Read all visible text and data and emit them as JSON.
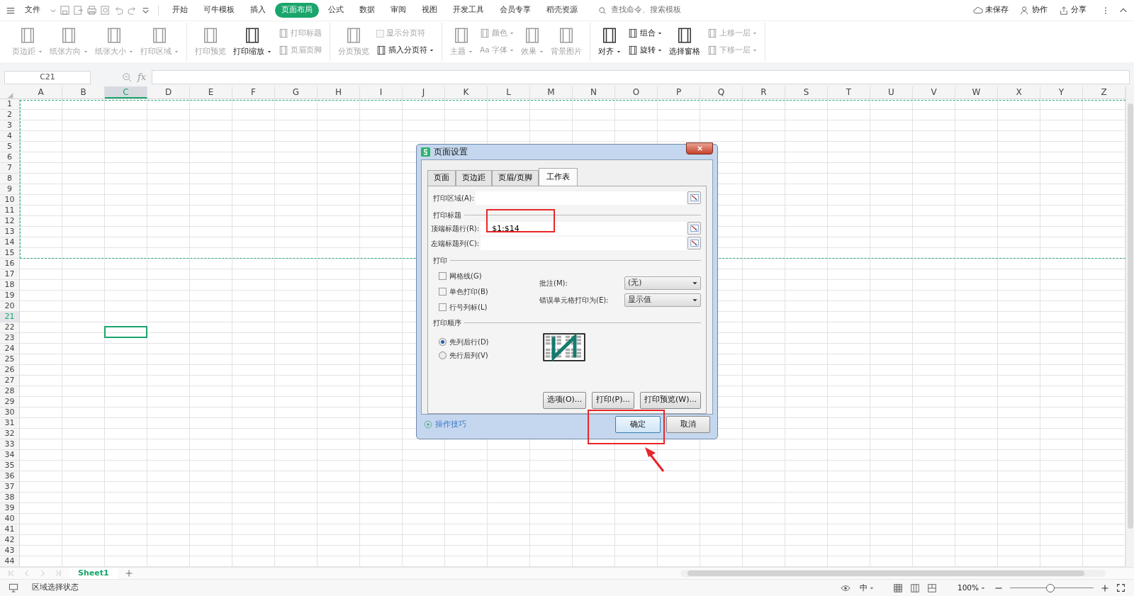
{
  "menu": {
    "file": "文件",
    "tabs": [
      {
        "label": "开始",
        "selected": false
      },
      {
        "label": "可牛模板",
        "selected": false
      },
      {
        "label": "插入",
        "selected": false
      },
      {
        "label": "页面布局",
        "selected": true
      },
      {
        "label": "公式",
        "selected": false
      },
      {
        "label": "数据",
        "selected": false
      },
      {
        "label": "审阅",
        "selected": false
      },
      {
        "label": "视图",
        "selected": false
      },
      {
        "label": "开发工具",
        "selected": false
      },
      {
        "label": "会员专享",
        "selected": false
      },
      {
        "label": "稻壳资源",
        "selected": false
      }
    ],
    "search": {
      "placeholder": "查找命令、搜索模板"
    },
    "actions": [
      {
        "label": "未保存",
        "kind": "cloud"
      },
      {
        "label": "协作",
        "kind": "person"
      },
      {
        "label": "分享",
        "kind": "share"
      }
    ]
  },
  "ribbon": [
    {
      "items": [
        {
          "kind": "large",
          "label": "页边距",
          "dropdown": true,
          "disabled": true
        },
        {
          "kind": "large",
          "label": "纸张方向",
          "dropdown": true,
          "disabled": true
        },
        {
          "kind": "large",
          "label": "纸张大小",
          "dropdown": true,
          "disabled": true
        },
        {
          "kind": "large",
          "label": "打印区域",
          "dropdown": true,
          "disabled": true
        }
      ]
    },
    {
      "items": [
        {
          "kind": "large",
          "label": "打印预览",
          "dropdown": false,
          "disabled": true
        },
        {
          "kind": "large",
          "label": "打印缩放",
          "dropdown": true,
          "disabled": false
        },
        {
          "kind": "stack",
          "items": [
            {
              "kind": "small",
              "label": "打印标题",
              "dropdown": false,
              "disabled": true
            },
            {
              "kind": "small",
              "label": "页眉页脚",
              "dropdown": false,
              "disabled": true
            }
          ]
        }
      ]
    },
    {
      "items": [
        {
          "kind": "large",
          "label": "分页预览",
          "dropdown": false,
          "disabled": true
        },
        {
          "kind": "stack",
          "items": [
            {
              "kind": "check",
              "label": "显示分页符",
              "checked": false,
              "disabled": true
            },
            {
              "kind": "small",
              "label": "插入分页符",
              "dropdown": true,
              "disabled": false
            }
          ]
        }
      ]
    },
    {
      "items": [
        {
          "kind": "large",
          "label": "主题",
          "dropdown": true,
          "disabled": true
        },
        {
          "kind": "stack",
          "items": [
            {
              "kind": "small",
              "label": "颜色",
              "dropdown": true,
              "disabled": true
            },
            {
              "kind": "small",
              "label": "字体",
              "glyph": "Aa",
              "dropdown": true,
              "disabled": true
            }
          ]
        },
        {
          "kind": "large",
          "label": "效果",
          "dropdown": true,
          "disabled": true
        },
        {
          "kind": "large",
          "label": "背景图片",
          "dropdown": false,
          "disabled": true
        }
      ]
    },
    {
      "items": [
        {
          "kind": "large",
          "label": "对齐",
          "dropdown": true,
          "disabled": false
        },
        {
          "kind": "stack",
          "items": [
            {
              "kind": "small",
              "label": "组合",
              "dropdown": true,
              "disabled": false
            },
            {
              "kind": "small",
              "label": "旋转",
              "dropdown": true,
              "disabled": false
            }
          ]
        },
        {
          "kind": "large",
          "label": "选择窗格",
          "dropdown": false,
          "disabled": false
        },
        {
          "kind": "stack",
          "items": [
            {
              "kind": "small",
              "label": "上移一层",
              "dropdown": true,
              "disabled": true
            },
            {
              "kind": "small",
              "label": "下移一层",
              "dropdown": true,
              "disabled": true
            }
          ]
        }
      ]
    }
  ],
  "formula_bar": {
    "name_box": "C21",
    "fx": "fx"
  },
  "sheet": {
    "columns": [
      {
        "label": "A",
        "selected": false
      },
      {
        "label": "B",
        "selected": false
      },
      {
        "label": "C",
        "selected": true
      },
      {
        "label": "D",
        "selected": false
      },
      {
        "label": "E",
        "selected": false
      },
      {
        "label": "F",
        "selected": false
      },
      {
        "label": "G",
        "selected": false
      },
      {
        "label": "H",
        "selected": false
      },
      {
        "label": "I",
        "selected": false
      },
      {
        "label": "J",
        "selected": false
      },
      {
        "label": "K",
        "selected": false
      },
      {
        "label": "L",
        "selected": false
      },
      {
        "label": "M",
        "selected": false
      },
      {
        "label": "N",
        "selected": false
      },
      {
        "label": "O",
        "selected": false
      },
      {
        "label": "P",
        "selected": false
      },
      {
        "label": "Q",
        "selected": false
      },
      {
        "label": "R",
        "selected": false
      },
      {
        "label": "S",
        "selected": false
      },
      {
        "label": "T",
        "selected": false
      },
      {
        "label": "U",
        "selected": false
      },
      {
        "label": "V",
        "selected": false
      },
      {
        "label": "W",
        "selected": false
      },
      {
        "label": "X",
        "selected": false
      },
      {
        "label": "Y",
        "selected": false
      },
      {
        "label": "Z",
        "selected": false
      }
    ],
    "rows": [
      {
        "label": "1",
        "selected": false
      },
      {
        "label": "2",
        "selected": false
      },
      {
        "label": "3",
        "selected": false
      },
      {
        "label": "4",
        "selected": false
      },
      {
        "label": "5",
        "selected": false
      },
      {
        "label": "6",
        "selected": false
      },
      {
        "label": "7",
        "selected": false
      },
      {
        "label": "8",
        "selected": false
      },
      {
        "label": "9",
        "selected": false
      },
      {
        "label": "10",
        "selected": false
      },
      {
        "label": "11",
        "selected": false
      },
      {
        "label": "12",
        "selected": false
      },
      {
        "label": "13",
        "selected": false
      },
      {
        "label": "14",
        "selected": false
      },
      {
        "label": "15",
        "selected": false
      },
      {
        "label": "16",
        "selected": false
      },
      {
        "label": "17",
        "selected": false
      },
      {
        "label": "18",
        "selected": false
      },
      {
        "label": "19",
        "selected": false
      },
      {
        "label": "20",
        "selected": false
      },
      {
        "label": "21",
        "selected": true
      },
      {
        "label": "22",
        "selected": false
      },
      {
        "label": "23",
        "selected": false
      },
      {
        "label": "24",
        "selected": false
      },
      {
        "label": "25",
        "selected": false
      },
      {
        "label": "26",
        "selected": false
      },
      {
        "label": "27",
        "selected": false
      },
      {
        "label": "28",
        "selected": false
      },
      {
        "label": "29",
        "selected": false
      },
      {
        "label": "30",
        "selected": false
      },
      {
        "label": "31",
        "selected": false
      },
      {
        "label": "32",
        "selected": false
      },
      {
        "label": "33",
        "selected": false
      },
      {
        "label": "34",
        "selected": false
      },
      {
        "label": "35",
        "selected": false
      },
      {
        "label": "36",
        "selected": false
      },
      {
        "label": "37",
        "selected": false
      },
      {
        "label": "38",
        "selected": false
      },
      {
        "label": "39",
        "selected": false
      },
      {
        "label": "40",
        "selected": false
      },
      {
        "label": "41",
        "selected": false
      },
      {
        "label": "42",
        "selected": false
      },
      {
        "label": "43",
        "selected": false
      },
      {
        "label": "44",
        "selected": false
      }
    ]
  },
  "dialog": {
    "title": "页面设置",
    "tabs": [
      {
        "label": "页面",
        "selected": false
      },
      {
        "label": "页边距",
        "selected": false
      },
      {
        "label": "页眉/页脚",
        "selected": false
      },
      {
        "label": "工作表",
        "selected": true
      }
    ],
    "print_area": {
      "label": "打印区域(A):"
    },
    "titles_section": "打印标题",
    "title_rows": {
      "label": "顶端标题行(R):",
      "value": "$1:$14"
    },
    "title_columns": {
      "label": "左端标题列(C):"
    },
    "print_section": "打印",
    "checks": [
      {
        "label": "网格线(G)",
        "checked": false
      },
      {
        "label": "单色打印(B)",
        "checked": false
      },
      {
        "label": "行号列标(L)",
        "checked": false
      }
    ],
    "selects": [
      {
        "label": "批注(M):",
        "value": "(无)"
      },
      {
        "label": "错误单元格打印为(E):",
        "value": "显示值"
      }
    ],
    "order_section": "打印顺序",
    "order": [
      {
        "label": "先列后行(D)",
        "selected": true
      },
      {
        "label": "先行后列(V)",
        "selected": false
      }
    ],
    "buttons": [
      "选项(O)...",
      "打印(P)...",
      "打印预览(W)..."
    ],
    "tip": "操作技巧",
    "ok": "确定",
    "cancel": "取消"
  },
  "sheet_tabs": [
    {
      "label": "Sheet1",
      "selected": true
    }
  ],
  "status_bar": {
    "text": "区域选择状态",
    "ime": "中",
    "zoom": "100%",
    "zoom_slider": {
      "level": 0.48
    }
  }
}
